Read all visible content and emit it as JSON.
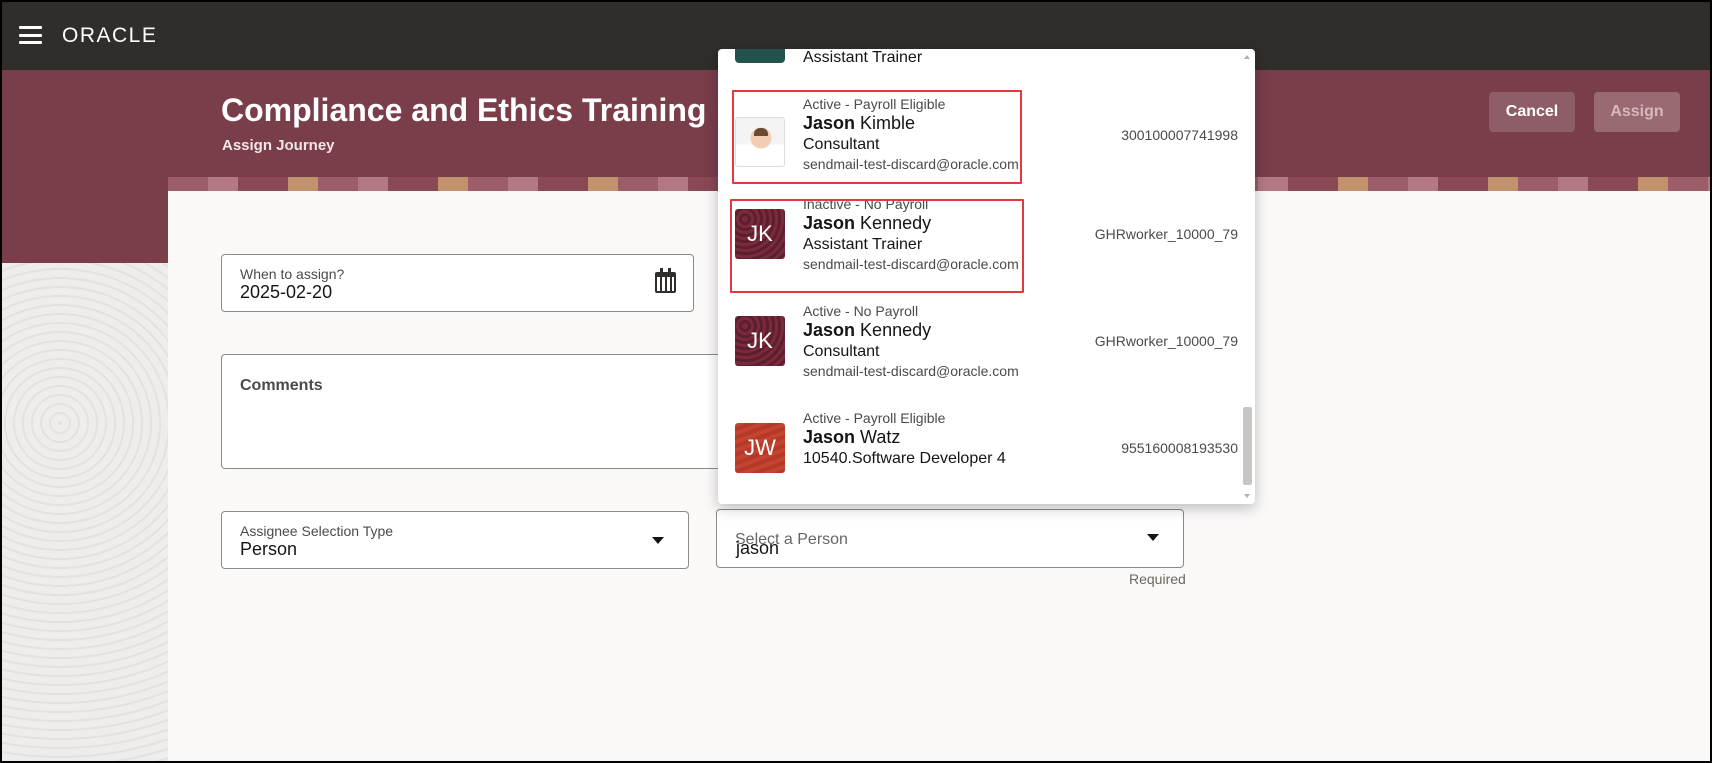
{
  "app": {
    "brand": "ORACLE"
  },
  "header": {
    "title": "Compliance and Ethics Training",
    "subtitle": "Assign Journey",
    "cancel_label": "Cancel",
    "assign_label": "Assign"
  },
  "form": {
    "when": {
      "label": "When to assign?",
      "value": "2025-02-20"
    },
    "comments": {
      "label": "Comments",
      "value": ""
    },
    "assignee_type": {
      "label": "Assignee Selection Type",
      "value": "Person"
    },
    "person": {
      "placeholder": "Select a Person",
      "typed_value": "jason",
      "required_text": "Required"
    }
  },
  "dropdown": {
    "partial_top_title": "Assistant Trainer",
    "options": [
      {
        "status": "Active - Payroll Eligible",
        "first": "Jason",
        "last": "Kimble",
        "title": "Consultant",
        "email": "sendmail-test-discard@oracle.com",
        "id": "300100007741998",
        "avatar": "photo",
        "highlighted": true
      },
      {
        "status": "Inactive - No Payroll",
        "first": "Jason",
        "last": "Kennedy",
        "title": "Assistant Trainer",
        "email": "sendmail-test-discard@oracle.com",
        "id": "GHRworker_10000_79",
        "avatar": "JK",
        "highlighted": true
      },
      {
        "status": "Active - No Payroll",
        "first": "Jason",
        "last": "Kennedy",
        "title": "Consultant",
        "email": "sendmail-test-discard@oracle.com",
        "id": "GHRworker_10000_79",
        "avatar": "JK",
        "highlighted": false
      },
      {
        "status": "Active - Payroll Eligible",
        "first": "Jason",
        "last": "Watz",
        "title": "10540.Software Developer 4",
        "email": "",
        "id": "955160008193530",
        "avatar": "JW",
        "highlighted": false
      }
    ]
  },
  "colors": {
    "topbar": "#312d2a",
    "header_band": "#7a3d4a",
    "highlight_border": "#e0393e"
  }
}
